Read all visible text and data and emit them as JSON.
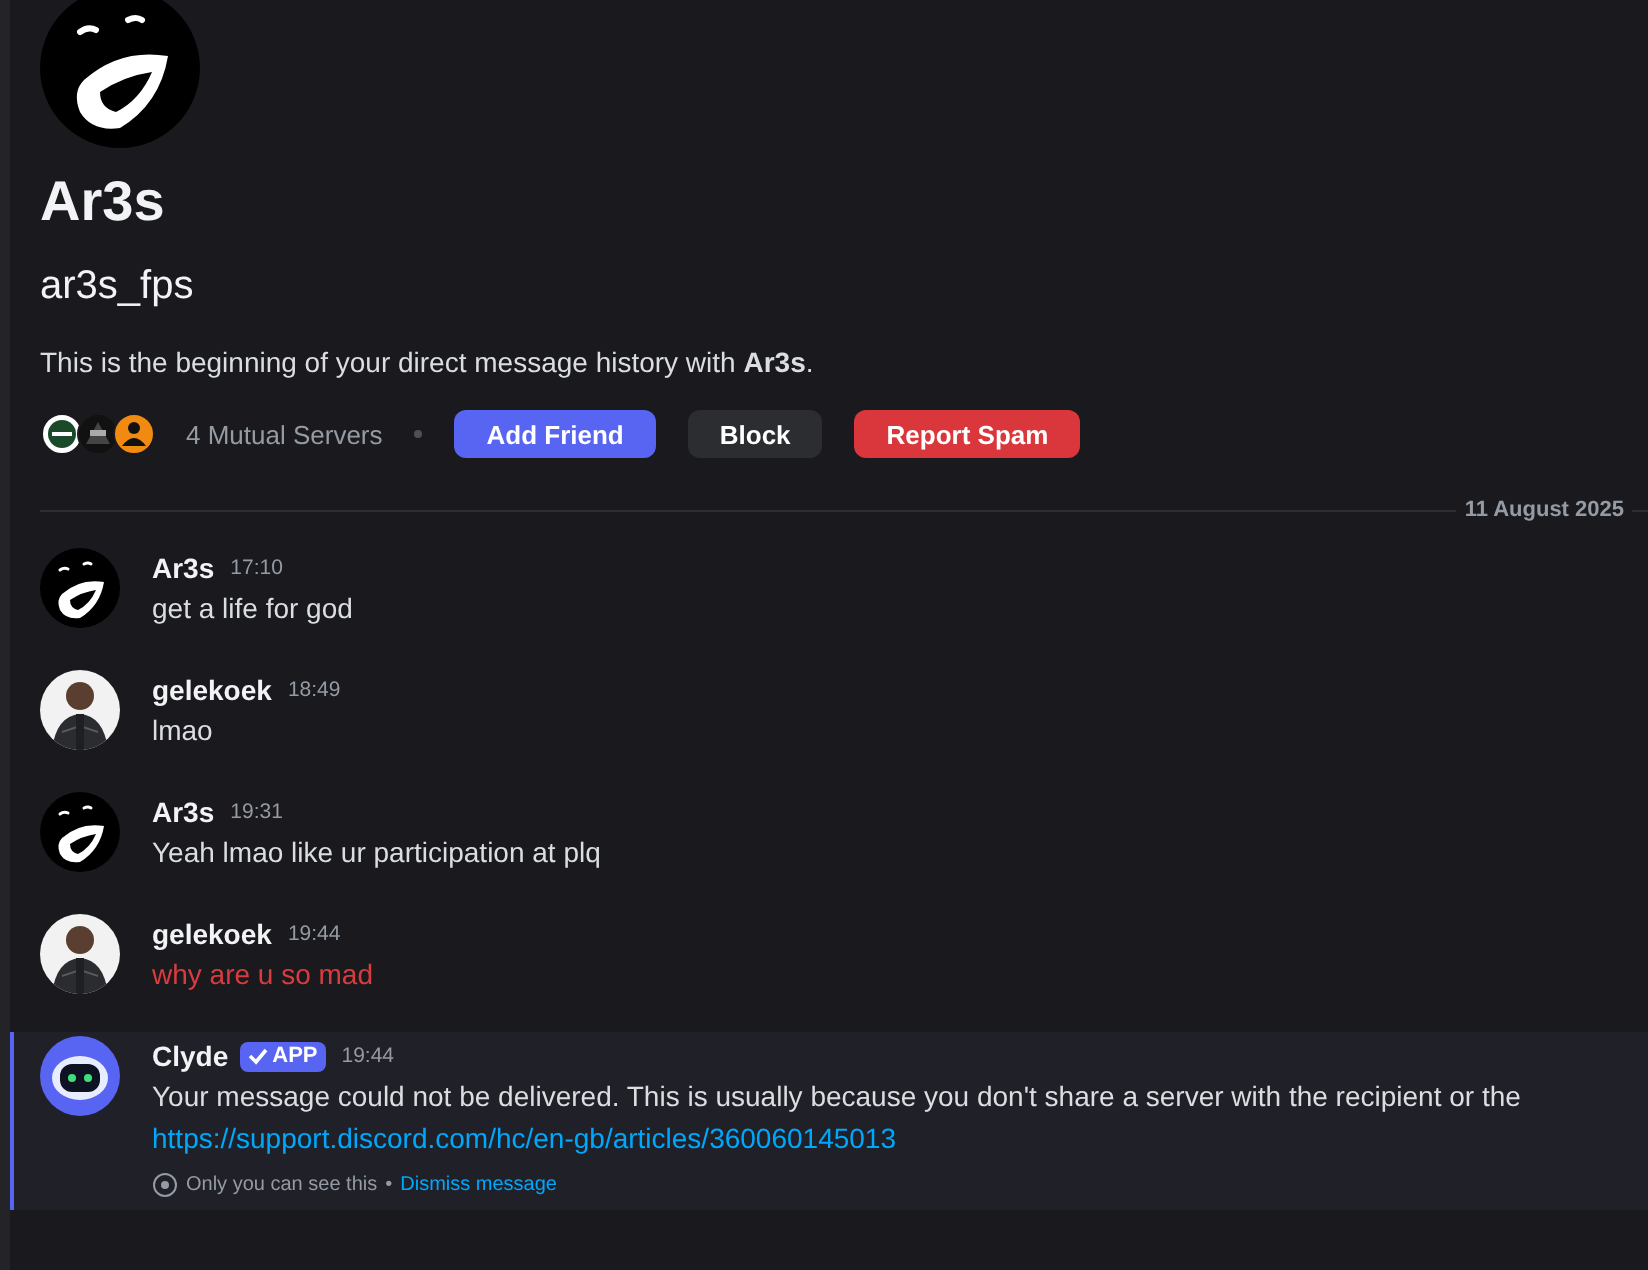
{
  "profile": {
    "display_name": "Ar3s",
    "username": "ar3s_fps",
    "intro": "This is the beginning of your direct message history with **Ar3s**.",
    "mutual_servers": "4 Mutual Servers",
    "buttons": [
      {
        "label": "Add Friend",
        "kind": "primary"
      },
      {
        "label": "Block",
        "kind": "secondary"
      },
      {
        "label": "Report Spam",
        "kind": "danger"
      }
    ]
  },
  "date_divider": "11 August 2025",
  "messages": [
    {
      "kind": "user",
      "avatar": {
        "kind": "drawing"
      },
      "author": "Ar3s",
      "time": "17:10",
      "text": "get a life for god",
      "failed": false
    },
    {
      "kind": "user",
      "author": "gelekoek",
      "time": "18:49",
      "text": "lmao",
      "failed": false
    },
    {
      "kind": "user",
      "avatar": {
        "kind": "drawing"
      },
      "author": "Ar3s",
      "time": "19:31",
      "text": "Yeah lmao like ur participation at plq",
      "failed": false
    },
    {
      "kind": "user",
      "author": "gelekoek",
      "time": "19:44",
      "text": "why are u so mad",
      "failed": true
    },
    {
      "kind": "app",
      "avatar": {
        "kind": "robot"
      },
      "author": "Clyde",
      "badge": "APP",
      "time": "19:44",
      "text": "Your message could not be delivered. This is usually because you don't share a server with the recipient or the",
      "link": "https://support.discord.com/hc/en-gb/articles/360060145013",
      "note": "Only you can see this",
      "separator": "•",
      "dismiss": "Dismiss message"
    }
  ]
}
